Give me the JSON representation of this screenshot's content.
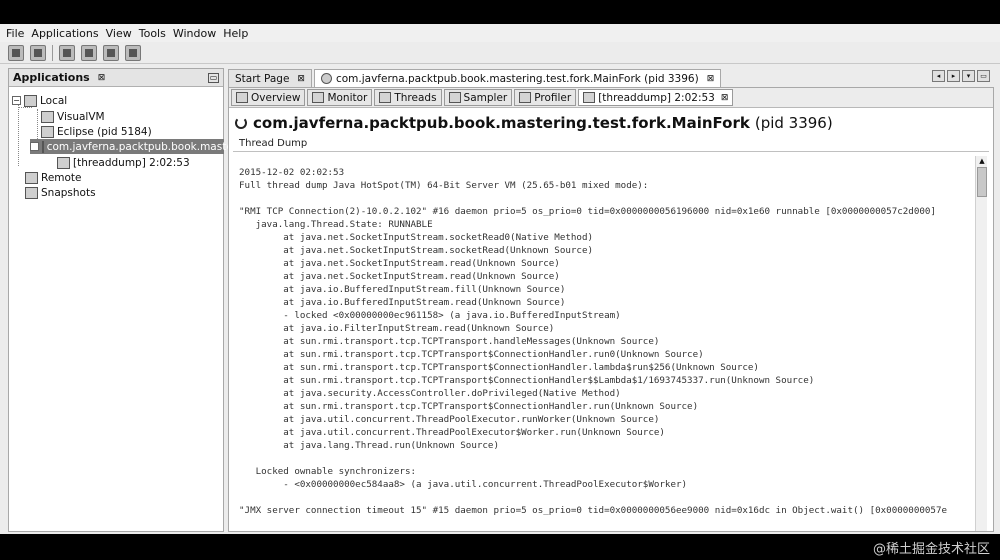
{
  "menu": [
    "File",
    "Applications",
    "View",
    "Tools",
    "Window",
    "Help"
  ],
  "toolbar_icons": [
    "load-icon",
    "save-icon",
    "add-application-icon",
    "add-jmx-icon",
    "heapdump-icon",
    "threaddump-icon"
  ],
  "left_panel": {
    "title": "Applications",
    "close": "⊠",
    "minimize": "▭",
    "tree": [
      {
        "label": "Local",
        "expander": "−"
      },
      {
        "label": "VisualVM"
      },
      {
        "label": "Eclipse (pid 5184)"
      },
      {
        "label": "com.javferna.packtpub.book.mastering.te",
        "expander": "−"
      },
      {
        "label": "[threaddump] 2:02:53"
      },
      {
        "label": "Remote"
      },
      {
        "label": "Snapshots"
      }
    ]
  },
  "doc_tabs": [
    {
      "label": "Start Page",
      "close": "⊠"
    },
    {
      "label": "com.javferna.packtpub.book.mastering.test.fork.MainFork (pid 3396)",
      "close": "⊠"
    }
  ],
  "tab_nav": [
    "◂",
    "▸",
    "▾",
    "▭"
  ],
  "sub_tabs": [
    {
      "label": "Overview"
    },
    {
      "label": "Monitor"
    },
    {
      "label": "Threads"
    },
    {
      "label": "Sampler"
    },
    {
      "label": "Profiler"
    },
    {
      "label": "[threaddump] 2:02:53",
      "close": "⊠"
    }
  ],
  "page": {
    "title": "com.javferna.packtpub.book.mastering.test.fork.MainFork",
    "pid": "(pid 3396)",
    "section_label": "Thread Dump"
  },
  "thread_dump": [
    "2015-12-02 02:02:53",
    "Full thread dump Java HotSpot(TM) 64-Bit Server VM (25.65-b01 mixed mode):",
    "",
    "\"RMI TCP Connection(2)-10.0.2.102\" #16 daemon prio=5 os_prio=0 tid=0x0000000056196000 nid=0x1e60 runnable [0x0000000057c2d000]",
    "   java.lang.Thread.State: RUNNABLE",
    "        at java.net.SocketInputStream.socketRead0(Native Method)",
    "        at java.net.SocketInputStream.socketRead(Unknown Source)",
    "        at java.net.SocketInputStream.read(Unknown Source)",
    "        at java.net.SocketInputStream.read(Unknown Source)",
    "        at java.io.BufferedInputStream.fill(Unknown Source)",
    "        at java.io.BufferedInputStream.read(Unknown Source)",
    "        - locked <0x00000000ec961158> (a java.io.BufferedInputStream)",
    "        at java.io.FilterInputStream.read(Unknown Source)",
    "        at sun.rmi.transport.tcp.TCPTransport.handleMessages(Unknown Source)",
    "        at sun.rmi.transport.tcp.TCPTransport$ConnectionHandler.run0(Unknown Source)",
    "        at sun.rmi.transport.tcp.TCPTransport$ConnectionHandler.lambda$run$256(Unknown Source)",
    "        at sun.rmi.transport.tcp.TCPTransport$ConnectionHandler$$Lambda$1/1693745337.run(Unknown Source)",
    "        at java.security.AccessController.doPrivileged(Native Method)",
    "        at sun.rmi.transport.tcp.TCPTransport$ConnectionHandler.run(Unknown Source)",
    "        at java.util.concurrent.ThreadPoolExecutor.runWorker(Unknown Source)",
    "        at java.util.concurrent.ThreadPoolExecutor$Worker.run(Unknown Source)",
    "        at java.lang.Thread.run(Unknown Source)",
    "",
    "   Locked ownable synchronizers:",
    "        - <0x00000000ec584aa8> (a java.util.concurrent.ThreadPoolExecutor$Worker)",
    "",
    "\"JMX server connection timeout 15\" #15 daemon prio=5 os_prio=0 tid=0x0000000056ee9000 nid=0x16dc in Object.wait() [0x0000000057e"
  ],
  "watermark": "@稀土掘金技术社区",
  "colors": {
    "selected_row": "#7a7a7a",
    "background": "#ececec"
  }
}
